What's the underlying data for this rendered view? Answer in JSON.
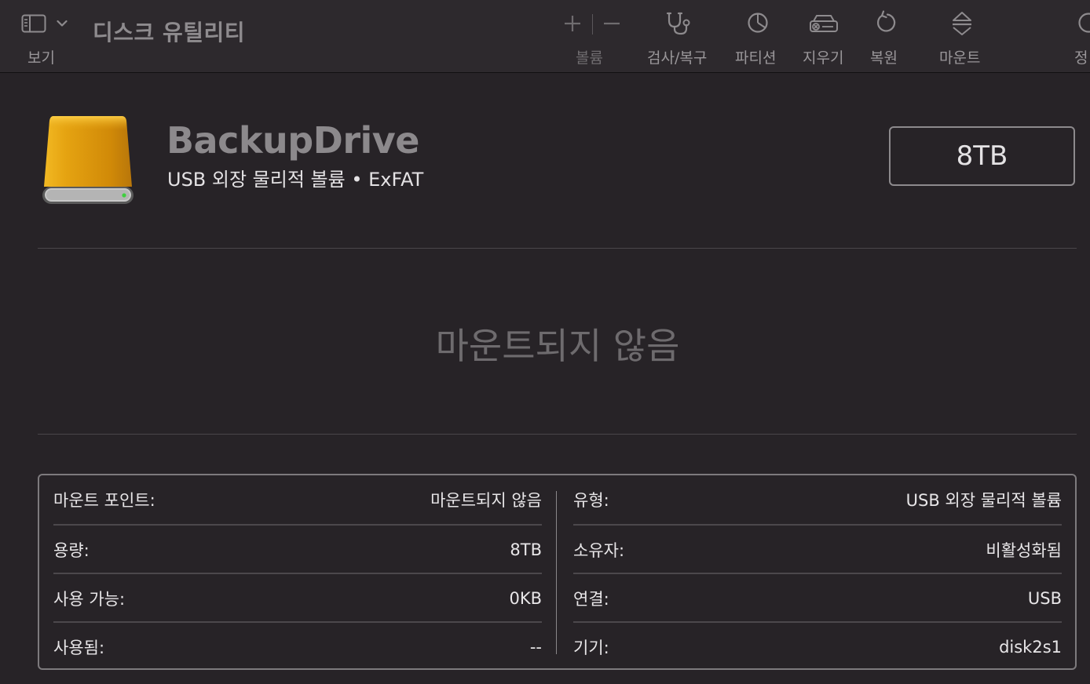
{
  "toolbar": {
    "view_label": "보기",
    "app_title": "디스크 유틸리티",
    "volume_label": "볼륨",
    "first_aid_label": "검사/복구",
    "partition_label": "파티션",
    "erase_label": "지우기",
    "restore_label": "복원",
    "mount_label": "마운트",
    "info_label": "정"
  },
  "drive": {
    "name": "BackupDrive",
    "subtitle": "USB 외장 물리적 볼륨 • ExFAT",
    "capacity": "8TB",
    "status": "마운트되지 않음"
  },
  "info": {
    "left": [
      {
        "key": "마운트 포인트:",
        "value": "마운트되지 않음"
      },
      {
        "key": "용량:",
        "value": "8TB"
      },
      {
        "key": "사용 가능:",
        "value": "0KB"
      },
      {
        "key": "사용됨:",
        "value": "--"
      }
    ],
    "right": [
      {
        "key": "유형:",
        "value": "USB 외장 물리적 볼륨"
      },
      {
        "key": "소유자:",
        "value": "비활성화됨"
      },
      {
        "key": "연결:",
        "value": "USB"
      },
      {
        "key": "기기:",
        "value": "disk2s1"
      }
    ]
  },
  "colors": {
    "window_bg": "#272327",
    "toolbar_bg": "#2d292d",
    "drive_gold": "#e5a311",
    "status_led": "#3fcf3f"
  }
}
